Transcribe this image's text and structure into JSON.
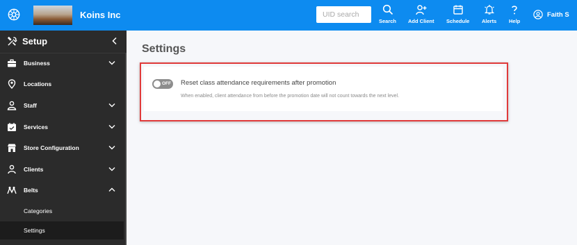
{
  "colors": {
    "topbar": "#0d8bf0",
    "sidebar": "#2b2b2b",
    "highlight": "#e03a3a"
  },
  "header": {
    "company": "Koins Inc",
    "search_placeholder": "UID search",
    "buttons": [
      {
        "label": "Search",
        "icon": "search-icon"
      },
      {
        "label": "Add Client",
        "icon": "add-user-icon"
      },
      {
        "label": "Schedule",
        "icon": "calendar-icon"
      },
      {
        "label": "Alerts",
        "icon": "bell-icon"
      },
      {
        "label": "Help",
        "icon": "question-icon"
      }
    ],
    "user": "Faith S"
  },
  "sidebar": {
    "title": "Setup",
    "items": [
      {
        "label": "Business",
        "icon": "briefcase-icon",
        "expandable": true
      },
      {
        "label": "Locations",
        "icon": "location-pin-icon",
        "expandable": false
      },
      {
        "label": "Staff",
        "icon": "staff-icon",
        "expandable": true
      },
      {
        "label": "Services",
        "icon": "services-icon",
        "expandable": true
      },
      {
        "label": "Store Configuration",
        "icon": "store-icon",
        "expandable": true
      },
      {
        "label": "Clients",
        "icon": "client-icon",
        "expandable": true
      },
      {
        "label": "Belts",
        "icon": "belts-icon",
        "expandable": true,
        "expanded": true
      }
    ],
    "subitems": [
      {
        "label": "Categories",
        "active": false
      },
      {
        "label": "Settings",
        "active": true
      }
    ]
  },
  "main": {
    "title": "Settings",
    "setting": {
      "toggle_state": "OFF",
      "label": "Reset class attendance requirements after promotion",
      "description": "When enabled, client attendance from before the promotion date will not count towards the next level."
    }
  }
}
